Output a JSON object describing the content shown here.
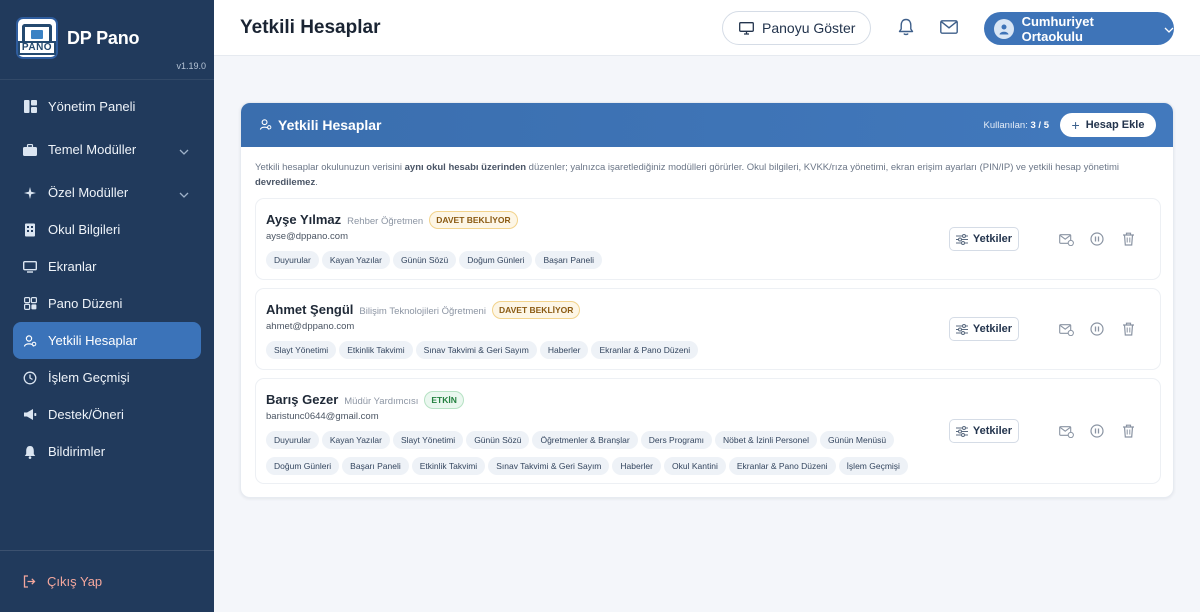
{
  "sidebar": {
    "brand": "DP Pano",
    "logo_text": "PANO",
    "version": "v1.19.0",
    "items": [
      {
        "label": "Yönetim Paneli",
        "icon": "dashboard-icon"
      },
      {
        "label": "Temel Modüller",
        "icon": "briefcase-icon",
        "expandable": true
      },
      {
        "label": "Özel Modüller",
        "icon": "sparkle-icon",
        "expandable": true
      },
      {
        "label": "Okul Bilgileri",
        "icon": "building-icon"
      },
      {
        "label": "Ekranlar",
        "icon": "monitor-icon"
      },
      {
        "label": "Pano Düzeni",
        "icon": "layout-icon"
      },
      {
        "label": "Yetkili Hesaplar",
        "icon": "users-icon",
        "active": true
      },
      {
        "label": "İşlem Geçmişi",
        "icon": "history-icon"
      },
      {
        "label": "Destek/Öneri",
        "icon": "megaphone-icon"
      },
      {
        "label": "Bildirimler",
        "icon": "bell-icon"
      }
    ],
    "logout": "Çıkış Yap"
  },
  "header": {
    "title": "Yetkili Hesaplar",
    "show_board": "Panoyu Göster",
    "account": "Cumhuriyet Ortaokulu"
  },
  "card": {
    "title": "Yetkili Hesaplar",
    "usage_label": "Kullanılan:",
    "usage_value": "3 / 5",
    "add_button": "Hesap Ekle",
    "notice": {
      "part1": "Yetkili hesaplar okulunuzun verisini ",
      "bold1": "aynı okul hesabı üzerinden",
      "part2": " düzenler; yalnızca işaretlediğiniz modülleri görürler. Okul bilgileri, KVKK/rıza yönetimi, ekran erişim ayarları (PIN/IP) ve yetkili hesap yönetimi ",
      "bold2": "devredilemez",
      "part3": "."
    },
    "permissions_button": "Yetkiler"
  },
  "accounts": [
    {
      "name": "Ayşe Yılmaz",
      "role": "Rehber Öğretmen",
      "status": "DAVET BEKLİYOR",
      "status_type": "pending",
      "email": "ayse@dppano.com",
      "modules": [
        "Duyurular",
        "Kayan Yazılar",
        "Günün Sözü",
        "Doğum Günleri",
        "Başarı Paneli"
      ]
    },
    {
      "name": "Ahmet Şengül",
      "role": "Bilişim Teknolojileri Öğretmeni",
      "status": "DAVET BEKLİYOR",
      "status_type": "pending",
      "email": "ahmet@dppano.com",
      "modules": [
        "Slayt Yönetimi",
        "Etkinlik Takvimi",
        "Sınav Takvimi & Geri Sayım",
        "Haberler",
        "Ekranlar & Pano Düzeni"
      ]
    },
    {
      "name": "Barış Gezer",
      "role": "Müdür Yardımcısı",
      "status": "ETKİN",
      "status_type": "active",
      "email": "baristunc0644@gmail.com",
      "modules": [
        "Duyurular",
        "Kayan Yazılar",
        "Slayt Yönetimi",
        "Günün Sözü",
        "Öğretmenler & Branşlar",
        "Ders Programı",
        "Nöbet & İzinli Personel",
        "Günün Menüsü",
        "Doğum Günleri",
        "Başarı Paneli",
        "Etkinlik Takvimi",
        "Sınav Takvimi & Geri Sayım",
        "Haberler",
        "Okul Kantini",
        "Ekranlar & Pano Düzeni",
        "İşlem Geçmişi"
      ]
    }
  ],
  "colors": {
    "sidebar_bg": "#213a5c",
    "accent": "#3b73b9",
    "pending_badge": "#8a5a12",
    "active_badge": "#23803f",
    "logout_text": "#f4a79d"
  }
}
